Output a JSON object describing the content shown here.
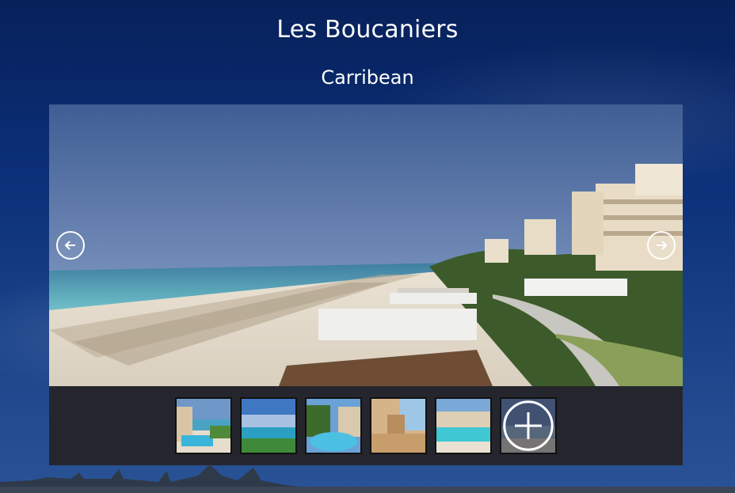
{
  "page": {
    "title": "Les Boucaniers",
    "subtitle": "Carribean"
  },
  "gallery": {
    "main_image": "beach-resort-photo",
    "prev_icon": "arrow-left-icon",
    "next_icon": "arrow-right-icon",
    "thumbnails": [
      {
        "name": "thumbnail-pool-beach"
      },
      {
        "name": "thumbnail-sea-view"
      },
      {
        "name": "thumbnail-pool-palms"
      },
      {
        "name": "thumbnail-terrace"
      },
      {
        "name": "thumbnail-resort-beach"
      },
      {
        "name": "thumbnail-more",
        "icon": "plus-icon"
      }
    ]
  },
  "colors": {
    "background": "#0b2f78",
    "panel": "#25262d",
    "text": "#ffffff"
  }
}
